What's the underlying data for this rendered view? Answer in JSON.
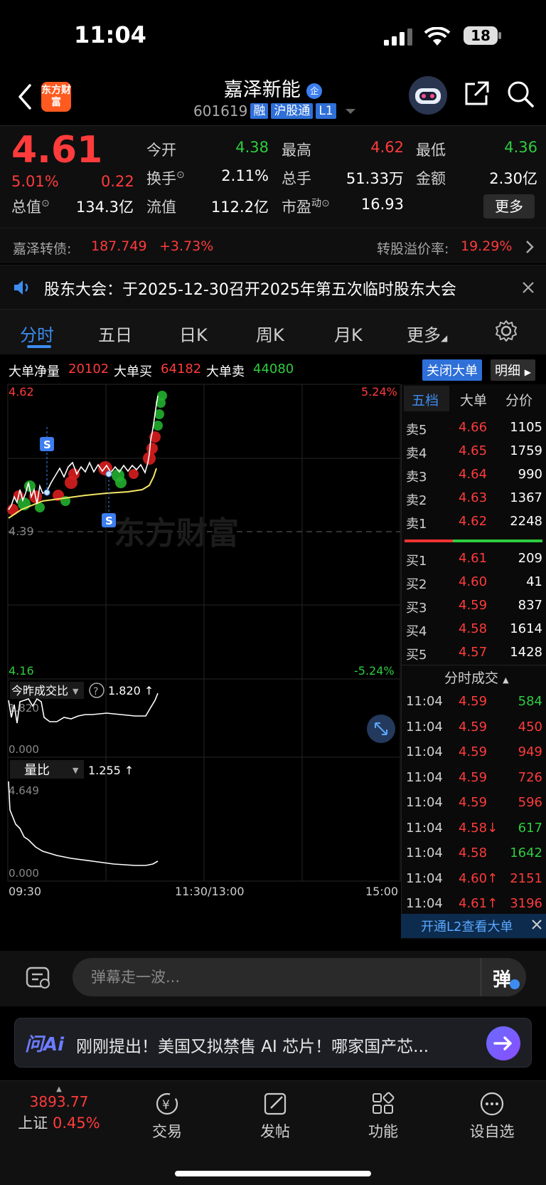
{
  "status": {
    "time": "11:04",
    "battery": "18"
  },
  "header": {
    "brand": "东方财富",
    "name": "嘉泽新能",
    "name_badge": "企",
    "code": "601619",
    "tags": [
      "融",
      "沪股通",
      "L1"
    ]
  },
  "quote": {
    "price": "4.61",
    "change_pct": "5.01%",
    "change_amt": "0.22",
    "open_label": "今开",
    "open": "4.38",
    "high_label": "最高",
    "high": "4.62",
    "low_label": "最低",
    "low": "4.36",
    "turnover_label": "换手",
    "turnover": "2.11%",
    "volume_label": "总手",
    "volume": "51.33万",
    "amount_label": "金额",
    "amount": "2.30亿",
    "mktcap_label": "总值",
    "mktcap": "134.3亿",
    "float_label": "流值",
    "float": "112.2亿",
    "pe_label": "市盈",
    "pe_sup": "动",
    "pe": "16.93",
    "more": "更多"
  },
  "convertible": {
    "label": "嘉泽转债:",
    "price": "187.749",
    "change": "+3.73%",
    "premium_label": "转股溢价率:",
    "premium": "19.29%"
  },
  "notice": {
    "text": "股东大会：于2025-12-30召开2025年第五次临时股东大会"
  },
  "tabs": [
    "分时",
    "五日",
    "日K",
    "周K",
    "月K",
    "更多"
  ],
  "bigorder": {
    "net_label": "大单净量",
    "net": "20102",
    "buy_label": "大单买",
    "buy": "64182",
    "sell_label": "大单卖",
    "sell": "44080",
    "close_btn": "关闭大单",
    "detail_btn": "明细"
  },
  "chart_data": {
    "type": "line",
    "price_high_label": "4.62",
    "price_low_label": "4.16",
    "pct_high_label": "5.24%",
    "pct_low_label": "-5.24%",
    "prev_close_label": "4.39",
    "watermark": "东方财富",
    "x_labels": [
      "09:30",
      "11:30/13:00",
      "15:00"
    ],
    "markers": [
      "S",
      "S"
    ],
    "ratio_label": "今昨成交比",
    "ratio_value": "1.820 ↑",
    "ratio_max": "1.820",
    "ratio_min": "0.000",
    "vol_ratio_label": "量比",
    "vol_ratio_value": "1.255 ↑",
    "vol_ratio_max": "4.649",
    "vol_ratio_min": "0.000"
  },
  "orderbook": {
    "tabs": [
      "五档",
      "大单",
      "分价"
    ],
    "asks": [
      {
        "label": "卖5",
        "price": "4.66",
        "vol": "1105"
      },
      {
        "label": "卖4",
        "price": "4.65",
        "vol": "1759"
      },
      {
        "label": "卖3",
        "price": "4.64",
        "vol": "990"
      },
      {
        "label": "卖2",
        "price": "4.63",
        "vol": "1367"
      },
      {
        "label": "卖1",
        "price": "4.62",
        "vol": "2248"
      }
    ],
    "bids": [
      {
        "label": "买1",
        "price": "4.61",
        "vol": "209"
      },
      {
        "label": "买2",
        "price": "4.60",
        "vol": "41"
      },
      {
        "label": "买3",
        "price": "4.59",
        "vol": "837"
      },
      {
        "label": "买4",
        "price": "4.58",
        "vol": "1614"
      },
      {
        "label": "买5",
        "price": "4.57",
        "vol": "1428"
      }
    ],
    "trades_title": "分时成交",
    "trades": [
      {
        "time": "11:04",
        "price": "4.59",
        "vol": "584",
        "color": "green"
      },
      {
        "time": "11:04",
        "price": "4.59",
        "vol": "450",
        "color": "red"
      },
      {
        "time": "11:04",
        "price": "4.59",
        "vol": "949",
        "color": "red"
      },
      {
        "time": "11:04",
        "price": "4.59",
        "vol": "726",
        "color": "red"
      },
      {
        "time": "11:04",
        "price": "4.59",
        "vol": "596",
        "color": "red"
      },
      {
        "time": "11:04",
        "price": "4.58↓",
        "vol": "617",
        "color": "green"
      },
      {
        "time": "11:04",
        "price": "4.58",
        "vol": "1642",
        "color": "green"
      },
      {
        "time": "11:04",
        "price": "4.60↑",
        "vol": "2151",
        "color": "red"
      },
      {
        "time": "11:04",
        "price": "4.61↑",
        "vol": "3196",
        "color": "red"
      }
    ],
    "l2": "开通L2查看大单"
  },
  "danmu": {
    "placeholder": "弹幕走一波...",
    "btn": "弹"
  },
  "ai": {
    "logo": "问Ai",
    "text": "刚刚提出！美国又拟禁售 AI 芯片！哪家国产芯..."
  },
  "nav": {
    "index_value": "3893.77",
    "index_name": "上证",
    "index_pct": "0.45%",
    "items": [
      "交易",
      "发帖",
      "功能",
      "设自选"
    ]
  },
  "colors": {
    "up": "#ff3b3b",
    "down": "#2ecc40",
    "accent": "#3d8cf0",
    "avg_line": "#f5e663"
  }
}
